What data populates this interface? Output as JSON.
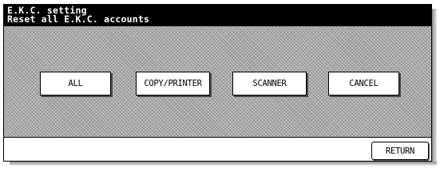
{
  "header": {
    "title": "E.K.C. setting",
    "subtitle": "Reset all E.K.C. accounts"
  },
  "buttons": {
    "all": "ALL",
    "copy_printer": "COPY/PRINTER",
    "scanner": "SCANNER",
    "cancel": "CANCEL"
  },
  "footer": {
    "return_label": "RETURN"
  }
}
